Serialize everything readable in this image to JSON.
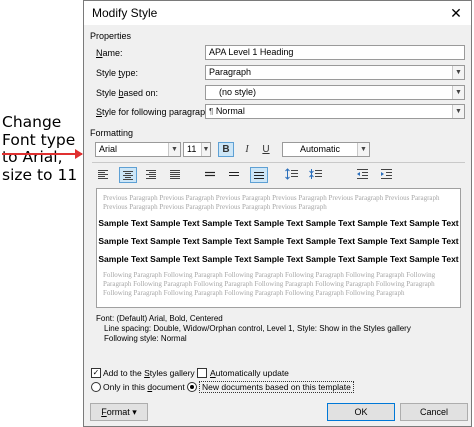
{
  "annotation": {
    "text": "Change Font type to Arial, size to 11",
    "lines": [
      "Change",
      "Font type",
      "to Arial,",
      "size to 11"
    ],
    "color": "#e03030"
  },
  "dialog": {
    "title": "Modify Style",
    "properties_heading": "Properties",
    "name_label": "Name:",
    "name_value": "APA Level 1 Heading",
    "style_type_label": "Style type:",
    "style_type_value": "Paragraph",
    "style_based_on_label": "Style based on:",
    "style_based_on_value": "(no style)",
    "following_label": "Style for following paragraph:",
    "following_value": "Normal",
    "formatting_heading": "Formatting",
    "font_value": "Arial",
    "size_value": "11",
    "color_value": "Automatic",
    "preview_previous": "Previous Paragraph Previous Paragraph Previous Paragraph Previous Paragraph Previous Paragraph Previous Paragraph Previous Paragraph Previous Paragraph Previous Paragraph Previous Paragraph",
    "sample_text": "Sample Text Sample Text Sample Text Sample Text Sample Text Sample Text Sample Text",
    "preview_following": "Following Paragraph Following Paragraph Following Paragraph Following Paragraph Following Paragraph Following Paragraph Following Paragraph Following Paragraph Following Paragraph Following Paragraph Following Paragraph Following Paragraph Following Paragraph Following Paragraph Following Paragraph Following Paragraph",
    "description_line1": "Font: (Default) Arial, Bold, Centered",
    "description_line2": "Line spacing:  Double, Widow/Orphan control, Level 1, Style: Show in the Styles gallery",
    "description_line3": "Following style: Normal",
    "add_to_gallery_label": "Add to the Styles gallery",
    "add_to_gallery_checked": true,
    "auto_update_label": "Automatically update",
    "auto_update_checked": false,
    "only_this_doc_label": "Only in this document",
    "new_docs_label": "New documents based on this template",
    "format_button": "Format",
    "ok_button": "OK",
    "cancel_button": "Cancel",
    "accent_color": "#0078d7",
    "highlight_color": "#cde6f7"
  }
}
